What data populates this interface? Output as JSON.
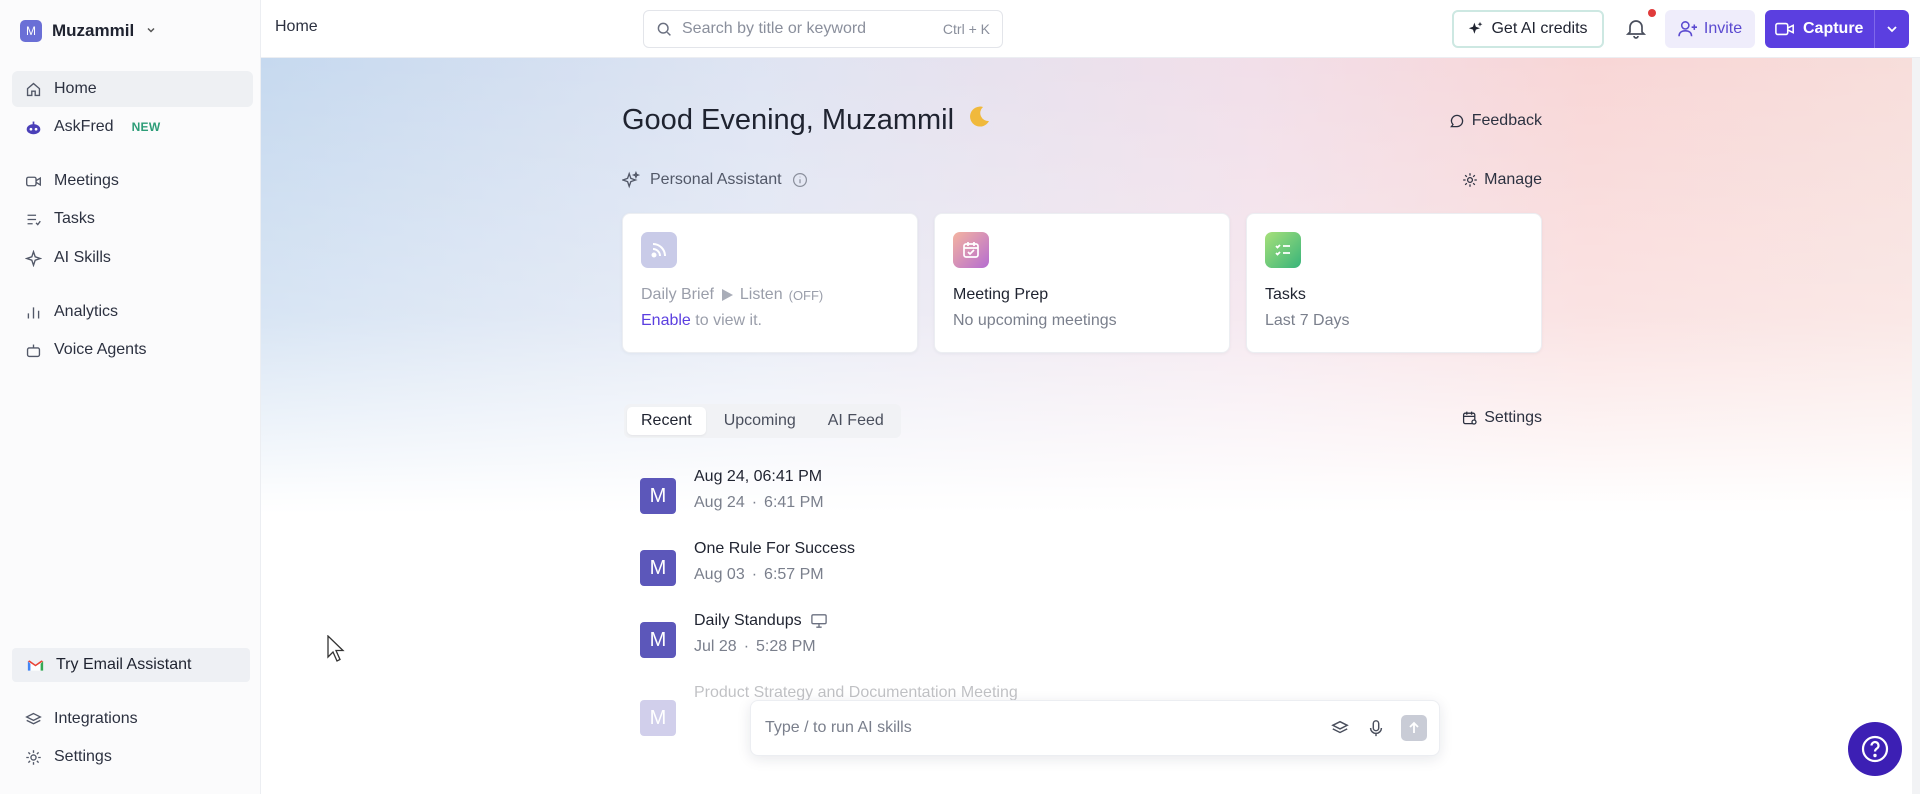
{
  "workspace": {
    "avatar_letter": "M",
    "name": "Muzammil"
  },
  "sidebar": {
    "items": [
      {
        "label": "Home"
      },
      {
        "label": "AskFred",
        "badge": "NEW"
      },
      {
        "label": "Meetings"
      },
      {
        "label": "Tasks"
      },
      {
        "label": "AI Skills"
      },
      {
        "label": "Analytics"
      },
      {
        "label": "Voice Agents"
      }
    ],
    "email_assistant": "Try Email Assistant",
    "bottom": [
      {
        "label": "Integrations"
      },
      {
        "label": "Settings"
      }
    ]
  },
  "topbar": {
    "breadcrumb": "Home",
    "search_placeholder": "Search by title or keyword",
    "search_shortcut": "Ctrl + K",
    "credits_label": "Get AI credits",
    "invite_label": "Invite",
    "capture_label": "Capture"
  },
  "main": {
    "greeting": "Good Evening, Muzammil",
    "feedback": "Feedback",
    "assistant_label": "Personal Assistant",
    "manage": "Manage",
    "cards": [
      {
        "title": "Daily Brief",
        "listen": "Listen",
        "off": "(OFF)",
        "enable": "Enable",
        "sub_rest": "to view it."
      },
      {
        "title": "Meeting Prep",
        "sub": "No upcoming meetings"
      },
      {
        "title": "Tasks",
        "sub": "Last 7 Days"
      }
    ],
    "tabs": [
      {
        "label": "Recent"
      },
      {
        "label": "Upcoming"
      },
      {
        "label": "AI Feed"
      }
    ],
    "settings": "Settings",
    "meetings": [
      {
        "avatar": "M",
        "title": "Aug 24, 06:41 PM",
        "date": "Aug 24",
        "dot": "·",
        "time": "6:41 PM"
      },
      {
        "avatar": "M",
        "title": "One Rule For Success",
        "date": "Aug 03",
        "dot": "·",
        "time": "6:57 PM"
      },
      {
        "avatar": "M",
        "title": "Daily Standups",
        "date": "Jul 28",
        "dot": "·",
        "time": "5:28 PM"
      },
      {
        "avatar": "M",
        "title": "Product Strategy and Documentation Meeting"
      }
    ]
  },
  "prompt": {
    "placeholder": "Type / to run AI skills"
  },
  "colors": {
    "accent": "#5b3fe0",
    "help": "#3c1fb4",
    "avatar": "#5c57ba"
  }
}
